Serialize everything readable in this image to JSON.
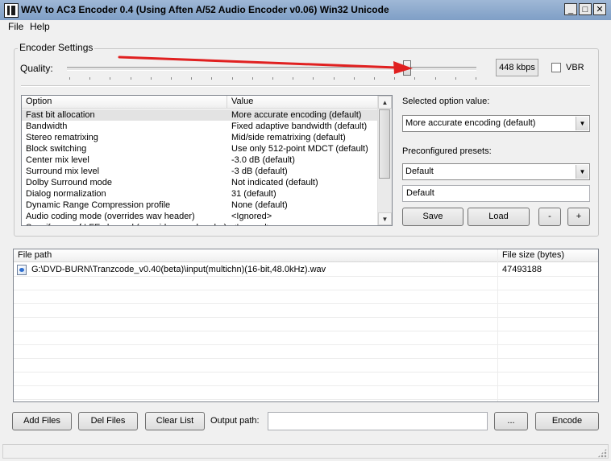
{
  "window": {
    "title": "WAV to AC3 Encoder 0.4 (Using Aften A/52 Audio Encoder v0.06) Win32 Unicode",
    "buttons": {
      "minimize": "_",
      "maximize": "□",
      "close": "✕"
    }
  },
  "menu": {
    "items": [
      "File",
      "Help"
    ]
  },
  "encoder_settings": {
    "group_label": "Encoder Settings",
    "quality_label": "Quality:",
    "quality_value_display": "448 kbps",
    "quality_slider_fraction": 0.83,
    "vbr_label": "VBR",
    "vbr_checked": false,
    "options_table": {
      "columns": [
        "Option",
        "Value"
      ],
      "rows": [
        [
          "Fast bit allocation",
          "More accurate encoding (default)"
        ],
        [
          "Bandwidth",
          "Fixed adaptive bandwidth (default)"
        ],
        [
          "Stereo rematrixing",
          "Mid/side rematrixing (default)"
        ],
        [
          "Block switching",
          "Use only 512-point MDCT (default)"
        ],
        [
          "Center mix level",
          "-3.0 dB (default)"
        ],
        [
          "Surround mix level",
          "-3 dB (default)"
        ],
        [
          "Dolby Surround mode",
          "Not indicated (default)"
        ],
        [
          "Dialog normalization",
          "31 (default)"
        ],
        [
          "Dynamic Range Compression profile",
          "None (default)"
        ],
        [
          "Audio coding mode (overrides wav header)",
          "<Ignored>"
        ],
        [
          "Specify use of LFE channel (overrides wav header)",
          "<Ignored>"
        ]
      ],
      "selected_index": 0
    },
    "selected_option_label": "Selected option value:",
    "selected_option_value": "More accurate encoding (default)",
    "presets_label": "Preconfigured presets:",
    "preset_selected": "Default",
    "preset_name": "Default",
    "buttons": {
      "save": "Save",
      "load": "Load",
      "minus": "-",
      "plus": "+"
    }
  },
  "files": {
    "columns": [
      "File path",
      "File size (bytes)"
    ],
    "rows": [
      [
        "G:\\DVD-BURN\\Tranzcode_v0.40(beta)\\input(multichn)(16-bit,48.0kHz).wav",
        "47493188"
      ]
    ]
  },
  "bottom": {
    "add_files": "Add Files",
    "del_files": "Del Files",
    "clear_list": "Clear List",
    "output_path_label": "Output path:",
    "output_path_value": "",
    "browse": "...",
    "encode": "Encode"
  },
  "colors": {
    "annotation_arrow": "#e02020",
    "titlebar": "#9fb8d6"
  }
}
